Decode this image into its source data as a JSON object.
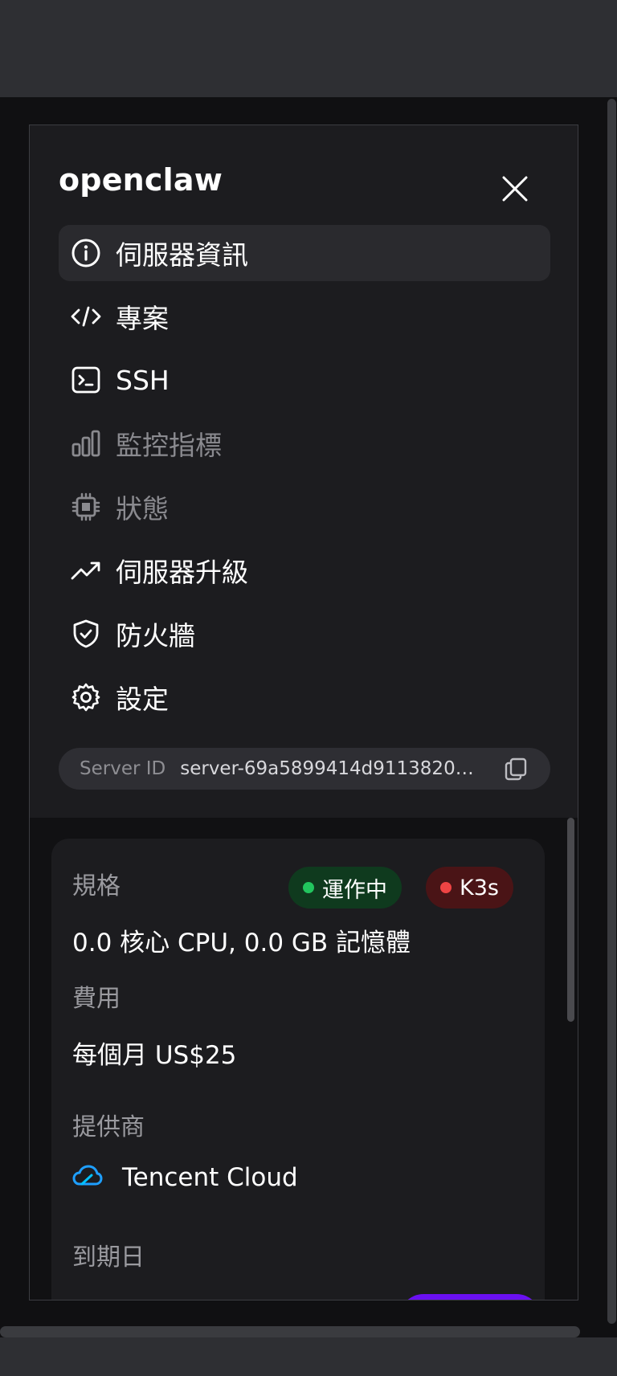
{
  "app": {
    "title": "openclaw"
  },
  "menu": {
    "items": [
      {
        "label": "伺服器資訊",
        "icon": "info-circle-icon",
        "state": "active"
      },
      {
        "label": "專案",
        "icon": "code-icon",
        "state": "normal"
      },
      {
        "label": "SSH",
        "icon": "terminal-icon",
        "state": "normal"
      },
      {
        "label": "監控指標",
        "icon": "bar-chart-icon",
        "state": "disabled"
      },
      {
        "label": "狀態",
        "icon": "cpu-chip-icon",
        "state": "disabled"
      },
      {
        "label": "伺服器升級",
        "icon": "trending-up-icon",
        "state": "normal"
      },
      {
        "label": "防火牆",
        "icon": "shield-check-icon",
        "state": "normal"
      },
      {
        "label": "設定",
        "icon": "gear-icon",
        "state": "normal"
      }
    ]
  },
  "server_id": {
    "label": "Server ID",
    "value": "server-69a5899414d9113820…",
    "icon": "copy-icon"
  },
  "card": {
    "spec_label": "規格",
    "spec_value": "0.0 核心 CPU, 0.0 GB 記憶體",
    "badges": {
      "running": "運作中",
      "k3s": "K3s"
    },
    "cost_label": "費用",
    "cost_value": "每個月 US$25",
    "provider_label": "提供商",
    "provider_value": "Tencent Cloud",
    "provider_icon": "tencent-cloud-icon",
    "expiry_label": "到期日"
  },
  "colors": {
    "background": "#101012",
    "panel": "#1c1c1f",
    "running_dot": "#22c55e",
    "k3s_dot": "#ef4444",
    "accent_purple": "#6a10f2"
  }
}
